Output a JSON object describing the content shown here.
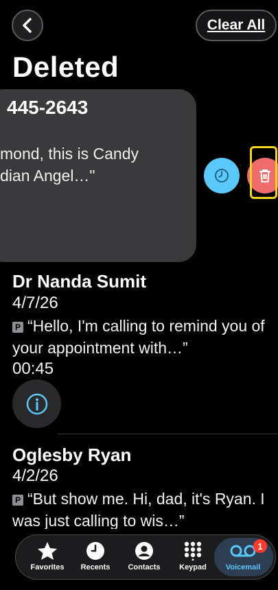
{
  "header": {
    "clear_all_label": "Clear All",
    "title": "Deleted"
  },
  "swiped_item": {
    "number": "445-2643",
    "snippet_line1": "mond, this is Candy",
    "snippet_line2": "dian Angel…\"",
    "actions": [
      "clock-icon",
      "trash-icon"
    ]
  },
  "voicemails": [
    {
      "name": "Dr Nanda Sumit",
      "date": "4/7/26",
      "text": "“Hello, I'm calling to remind you of your appointment with…”",
      "duration": "00:45"
    },
    {
      "name": "Oglesby Ryan",
      "date": "4/2/26",
      "text": "“But show me.  Hi, dad, it's Ryan.  I was just calling to wis…”"
    }
  ],
  "tabs": [
    {
      "label": "Favorites",
      "icon": "star-icon"
    },
    {
      "label": "Recents",
      "icon": "clock-icon"
    },
    {
      "label": "Contacts",
      "icon": "person-icon"
    },
    {
      "label": "Keypad",
      "icon": "keypad-icon"
    },
    {
      "label": "Voicemail",
      "icon": "voicemail-icon",
      "active": true,
      "badge": "1"
    }
  ],
  "colors": {
    "background": "#000000",
    "accent": "#5ac8fa",
    "delete": "#f06d6d",
    "highlight": "#f5d320",
    "badge": "#ff3b30"
  }
}
